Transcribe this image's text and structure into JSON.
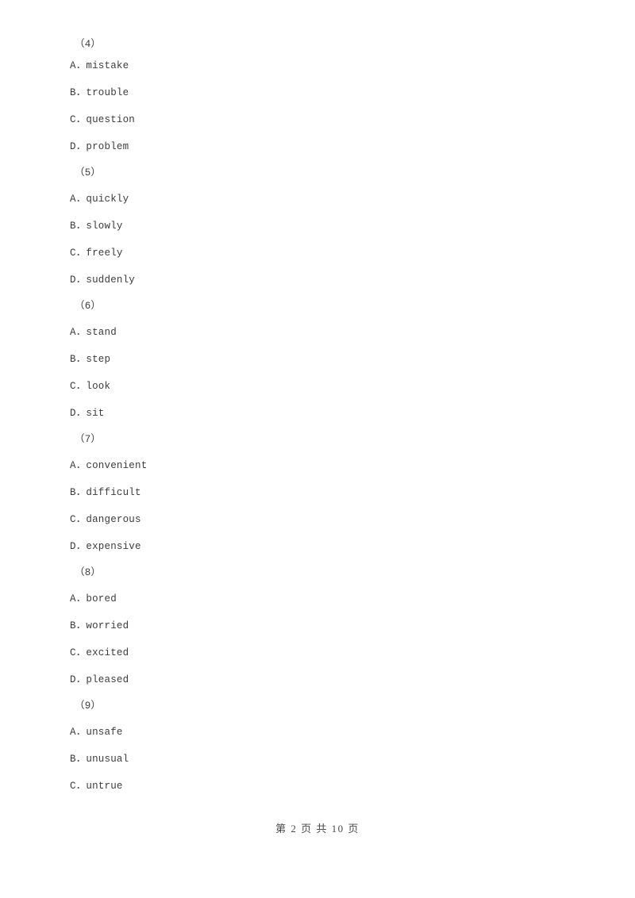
{
  "document": {
    "page_background": "#ffffff",
    "text_color": "#3c3c3c"
  },
  "question_groups": [
    {
      "number": "（4）",
      "options": [
        {
          "letter": "A",
          "separator": "．",
          "text": "mistake",
          "full": "A．mistake"
        },
        {
          "letter": "B",
          "separator": "．",
          "text": "trouble",
          "full": "B．trouble"
        },
        {
          "letter": "C",
          "separator": "．",
          "text": "question",
          "full": "C．question"
        },
        {
          "letter": "D",
          "separator": "．",
          "text": "problem",
          "full": "D．problem"
        }
      ]
    },
    {
      "number": "（5）",
      "options": [
        {
          "letter": "A",
          "separator": "．",
          "text": "quickly",
          "full": "A．quickly"
        },
        {
          "letter": "B",
          "separator": "．",
          "text": "slowly",
          "full": "B．slowly"
        },
        {
          "letter": "C",
          "separator": "．",
          "text": "freely",
          "full": "C．freely"
        },
        {
          "letter": "D",
          "separator": "．",
          "text": "suddenly",
          "full": "D．suddenly"
        }
      ]
    },
    {
      "number": "（6）",
      "options": [
        {
          "letter": "A",
          "separator": "．",
          "text": "stand",
          "full": "A．stand"
        },
        {
          "letter": "B",
          "separator": "．",
          "text": "step",
          "full": "B．step"
        },
        {
          "letter": "C",
          "separator": "．",
          "text": "look",
          "full": "C．look"
        },
        {
          "letter": "D",
          "separator": "．",
          "text": "sit",
          "full": "D．sit"
        }
      ]
    },
    {
      "number": "（7）",
      "options": [
        {
          "letter": "A",
          "separator": "．",
          "text": "convenient",
          "full": "A．convenient"
        },
        {
          "letter": "B",
          "separator": "．",
          "text": "difficult",
          "full": "B．difficult"
        },
        {
          "letter": "C",
          "separator": "．",
          "text": "dangerous",
          "full": "C．dangerous"
        },
        {
          "letter": "D",
          "separator": "．",
          "text": "expensive",
          "full": "D．expensive"
        }
      ]
    },
    {
      "number": "（8）",
      "options": [
        {
          "letter": "A",
          "separator": "．",
          "text": "bored",
          "full": "A．bored"
        },
        {
          "letter": "B",
          "separator": "．",
          "text": "worried",
          "full": "B．worried"
        },
        {
          "letter": "C",
          "separator": "．",
          "text": "excited",
          "full": "C．excited"
        },
        {
          "letter": "D",
          "separator": "．",
          "text": "pleased",
          "full": "D．pleased"
        }
      ]
    },
    {
      "number": "（9）",
      "options": [
        {
          "letter": "A",
          "separator": "．",
          "text": "unsafe",
          "full": "A．unsafe"
        },
        {
          "letter": "B",
          "separator": "．",
          "text": "unusual",
          "full": "B．unusual"
        },
        {
          "letter": "C",
          "separator": "．",
          "text": "untrue",
          "full": "C．untrue"
        }
      ]
    }
  ],
  "footer": {
    "full_text": "第 2 页 共 10 页",
    "prefix": "第",
    "current_page": "2",
    "page_unit": "页",
    "middle": "共",
    "total_pages": "10",
    "page_unit_2": "页"
  }
}
